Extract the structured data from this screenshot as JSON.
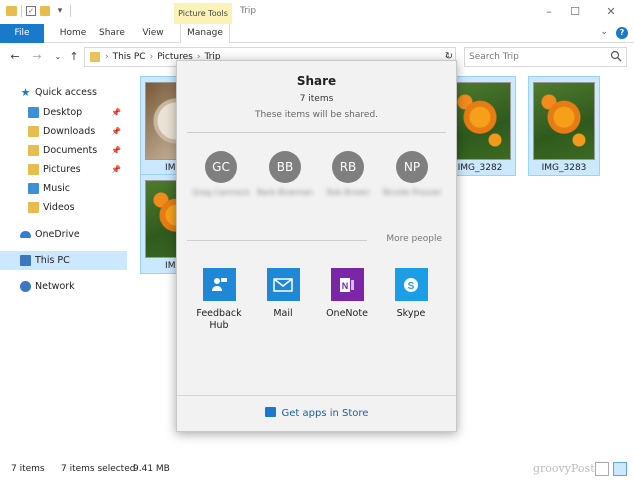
{
  "titlebar": {
    "context_tab": "Picture Tools",
    "window_title": "Trip",
    "minimize": "–",
    "maximize": "☐",
    "close": "✕"
  },
  "ribbon": {
    "tabs": [
      "File",
      "Home",
      "Share",
      "View",
      "Manage"
    ],
    "collapse_glyph": "⌄"
  },
  "address": {
    "crumbs": [
      "This PC",
      "Pictures",
      "Trip"
    ],
    "search_placeholder": "Search Trip"
  },
  "navpane": {
    "items": [
      {
        "label": "Quick access",
        "icon": "star-icon"
      },
      {
        "label": "Desktop",
        "icon": "folder-icon",
        "pinned": true
      },
      {
        "label": "Downloads",
        "icon": "folder-icon",
        "pinned": true
      },
      {
        "label": "Documents",
        "icon": "folder-icon",
        "pinned": true
      },
      {
        "label": "Pictures",
        "icon": "folder-icon",
        "pinned": true
      },
      {
        "label": "Music",
        "icon": "folder-icon"
      },
      {
        "label": "Videos",
        "icon": "folder-icon"
      },
      {
        "label": "OneDrive",
        "icon": "cloud-icon"
      },
      {
        "label": "This PC",
        "icon": "computer-icon"
      },
      {
        "label": "Network",
        "icon": "network-icon"
      }
    ]
  },
  "files": [
    {
      "name": "IMG_",
      "kind": "food"
    },
    {
      "name": "IMG_3282",
      "kind": "flower"
    },
    {
      "name": "IMG_3283",
      "kind": "flower"
    },
    {
      "name": "IMG_",
      "kind": "flower"
    }
  ],
  "share": {
    "title": "Share",
    "count": "7 items",
    "subtitle": "These items will be shared.",
    "people": [
      {
        "initials": "GC",
        "name": "Greg Carmack"
      },
      {
        "initials": "BB",
        "name": "Barb Bowman"
      },
      {
        "initials": "RB",
        "name": "Rob Brown"
      },
      {
        "initials": "NP",
        "name": "Nicolle Prosser"
      }
    ],
    "more_people": "More people",
    "apps": [
      {
        "label": "Feedback Hub",
        "color": "#1e88d6"
      },
      {
        "label": "Mail",
        "color": "#1e88d6"
      },
      {
        "label": "OneNote",
        "color": "#7b26a8"
      },
      {
        "label": "Skype",
        "color": "#1c9ee6"
      }
    ],
    "footer": "Get apps in Store"
  },
  "status": {
    "count": "7 items",
    "selected": "7 items selected",
    "size": "9.41 MB",
    "watermark": "groovyPost"
  }
}
